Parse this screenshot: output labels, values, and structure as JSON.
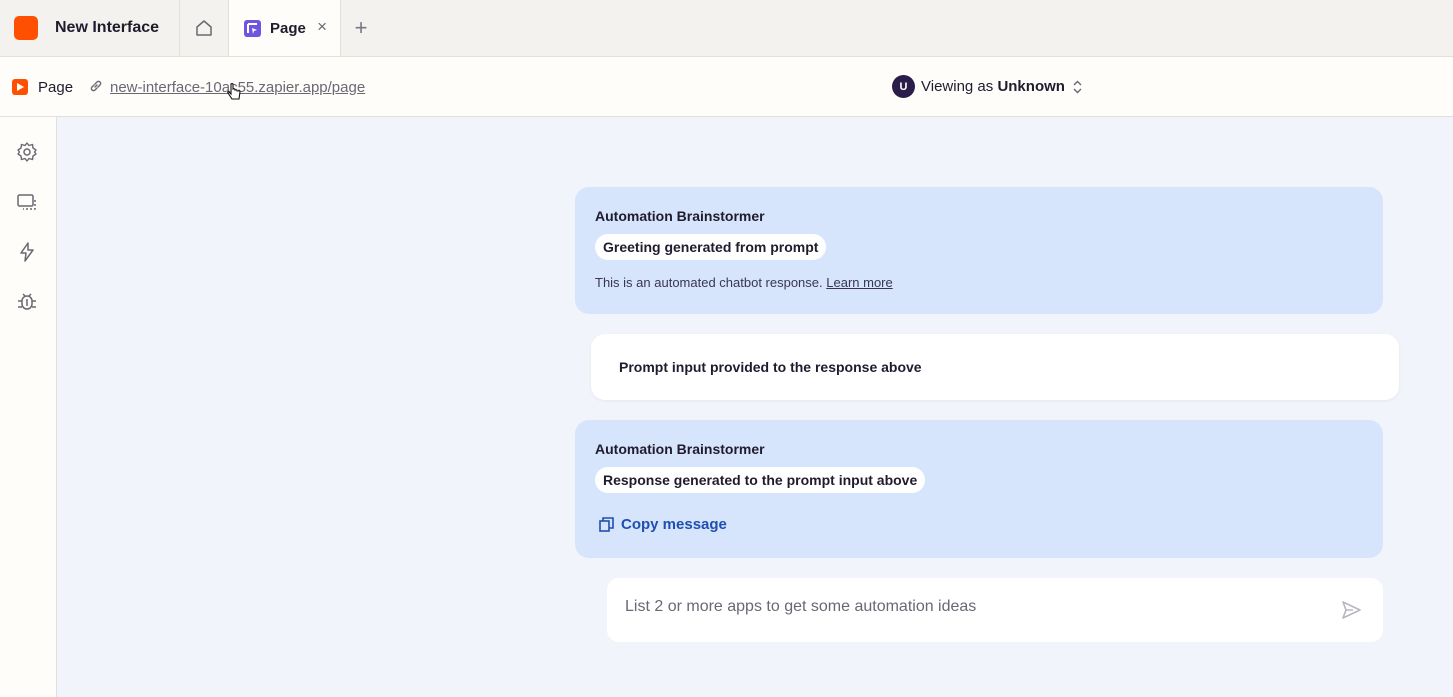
{
  "tabbar": {
    "app_title": "New Interface",
    "page_tab_label": "Page",
    "close_glyph": "×",
    "add_glyph": "+"
  },
  "subbar": {
    "page_label": "Page",
    "url": "new-interface-10ac55.zapier.app/page",
    "avatar_initial": "U",
    "viewing_prefix": "Viewing as ",
    "viewing_user": "Unknown"
  },
  "sidebar": {
    "items": [
      {
        "icon": "gear-icon"
      },
      {
        "icon": "layout-icon"
      },
      {
        "icon": "lightning-icon"
      },
      {
        "icon": "bug-icon"
      }
    ]
  },
  "chat": {
    "messages": [
      {
        "author": "Automation Brainstormer",
        "pill": "Greeting generated from prompt",
        "note": "This is an automated chatbot response. ",
        "note_link": "Learn more"
      },
      {
        "user_text": "Prompt input provided to the response above"
      },
      {
        "author": "Automation Brainstormer",
        "pill": "Response generated to the prompt input above",
        "copy_label": "Copy message"
      }
    ],
    "input_placeholder": "List 2 or more apps to get some automation ideas"
  },
  "colors": {
    "brand": "#ff4f00",
    "bot_bubble": "#d6e5fb",
    "link_blue": "#1f4fb0"
  }
}
